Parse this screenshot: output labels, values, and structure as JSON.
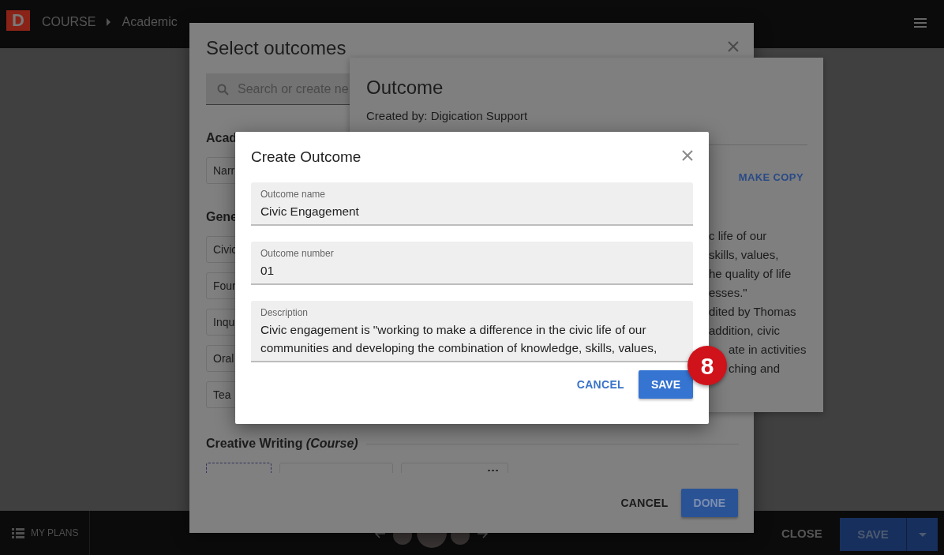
{
  "top_bar": {
    "logo": "D",
    "breadcrumb": [
      "COURSE",
      "Academic"
    ]
  },
  "select_dialog": {
    "title": "Select outcomes",
    "search": {
      "placeholder": "Search or create ne"
    },
    "sections": [
      {
        "title": "Acad",
        "chips": [
          "Narr"
        ]
      },
      {
        "title": "Gene",
        "chips": [
          "Civic",
          "Four",
          "Inqu",
          "Oral",
          "Tea"
        ]
      }
    ],
    "creative": {
      "title": "Creative Writing *(Course)*",
      "chips": [
        {
          "kind": "dashed"
        },
        {
          "kind": "plain"
        },
        {
          "kind": "menu"
        }
      ]
    },
    "buttons": [
      {
        "label": "CANCEL",
        "kind": "text"
      },
      {
        "label": "DONE",
        "kind": "primary"
      }
    ]
  },
  "outcome_panel": {
    "title": "Outcome",
    "created_by": "Created by: Digication Support",
    "action": "MAKE COPY",
    "description_lines": [
      {
        "text": "c life of our",
        "kind": "edge"
      },
      {
        "text": "skills, values,",
        "kind": "edge"
      },
      {
        "text": "he quality of life",
        "kind": "edge"
      },
      {
        "text": "esses.\"",
        "kind": "edge"
      },
      {
        "text": "dited by Thomas",
        "kind": "edge"
      },
      {
        "text": "addition, civic",
        "kind": "edge"
      },
      {
        "text": "ate in activities",
        "kind": "inset"
      },
      {
        "text": "ching and",
        "kind": "inset"
      }
    ]
  },
  "create_dialog": {
    "title": "Create Outcome",
    "fields": [
      {
        "label": "Outcome name",
        "value": "Civic Engagement",
        "kind": "input"
      },
      {
        "label": "Outcome number",
        "value": "01",
        "kind": "input"
      },
      {
        "label": "Description",
        "value": "Civic engagement is \"working to make a difference in the civic life of our communities and developing the combination of knowledge, skills, values,",
        "kind": "textarea"
      }
    ],
    "buttons": [
      {
        "label": "CANCEL",
        "kind": "text"
      },
      {
        "label": "SAVE",
        "kind": "primary"
      }
    ]
  },
  "step_badge": "8",
  "bottom_bar": {
    "my_plans": "MY PLANS",
    "close": "CLOSE",
    "save": "SAVE"
  }
}
